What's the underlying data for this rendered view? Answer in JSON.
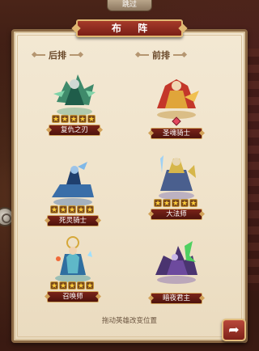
{
  "top_bar": {
    "skip_label": "跳过"
  },
  "panel": {
    "title": "布 阵",
    "back_row_label": "后排",
    "front_row_label": "前排",
    "hint": "拖动英雄改变位置"
  },
  "heroes": [
    {
      "slot": "back-1",
      "name": "复仇之刃",
      "stars": 5,
      "palette": "green"
    },
    {
      "slot": "front-1",
      "name": "圣魂骑士",
      "stars": 5,
      "palette": "red"
    },
    {
      "slot": "back-2",
      "name": "死灵骑士",
      "stars": 5,
      "palette": "blue"
    },
    {
      "slot": "front-2",
      "name": "大法师",
      "stars": 5,
      "palette": "gold"
    },
    {
      "slot": "back-3",
      "name": "召唤师",
      "stars": 5,
      "palette": "teal"
    },
    {
      "slot": "front-3",
      "name": "暗夜君主",
      "stars": 0,
      "palette": "purple"
    }
  ],
  "icons": {
    "back_button": "return-arrow-icon",
    "star": "star-icon",
    "side_button": "orb-icon"
  },
  "colors": {
    "ribbon": "#a53a2a",
    "parchment": "#f3e8d3",
    "star": "#ffcf3a",
    "name_plate": "#7a2318"
  }
}
